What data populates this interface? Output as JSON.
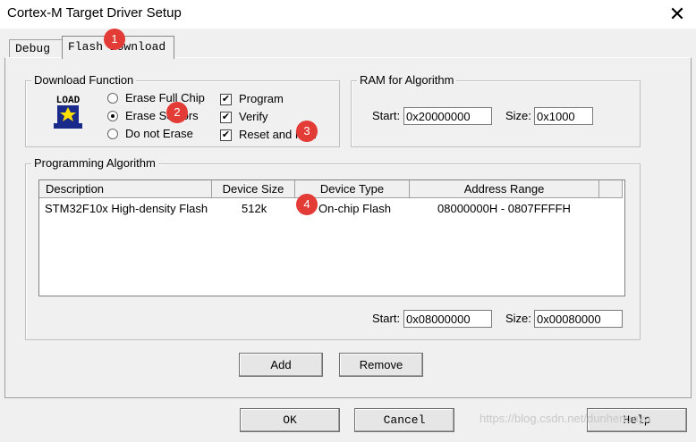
{
  "window": {
    "title": "Cortex-M Target Driver Setup",
    "close_glyph": "✕"
  },
  "tabs": [
    {
      "label": "Debug"
    },
    {
      "label": "Flash Download"
    }
  ],
  "download_function": {
    "legend": "Download Function",
    "icon_text": "LOAD",
    "radios": [
      {
        "label": "Erase Full Chip",
        "selected": false
      },
      {
        "label": "Erase Sectors",
        "selected": true
      },
      {
        "label": "Do not Erase",
        "selected": false
      }
    ],
    "checks": [
      {
        "label": "Program",
        "checked": true
      },
      {
        "label": "Verify",
        "checked": true
      },
      {
        "label": "Reset and Run",
        "checked": true
      }
    ]
  },
  "ram_for_algorithm": {
    "legend": "RAM for Algorithm",
    "start_label": "Start:",
    "start_value": "0x20000000",
    "size_label": "Size:",
    "size_value": "0x1000"
  },
  "programming_algorithm": {
    "legend": "Programming Algorithm",
    "columns": [
      "Description",
      "Device Size",
      "Device Type",
      "Address Range"
    ],
    "rows": [
      {
        "description": "STM32F10x High-density Flash",
        "size": "512k",
        "type": "On-chip Flash",
        "range": "08000000H - 0807FFFFH"
      }
    ],
    "start_label": "Start:",
    "start_value": "0x08000000",
    "size_label": "Size:",
    "size_value": "0x00080000",
    "add_label": "Add",
    "remove_label": "Remove"
  },
  "footer": {
    "ok_label": "OK",
    "cancel_label": "Cancel",
    "help_label": "Help"
  },
  "annotations": [
    "1",
    "2",
    "3",
    "4"
  ],
  "watermark": "https://blog.csdn.net/dunhenuaya",
  "colors": {
    "badge": "#e33b36",
    "window_bg": "#f0f0f0"
  }
}
